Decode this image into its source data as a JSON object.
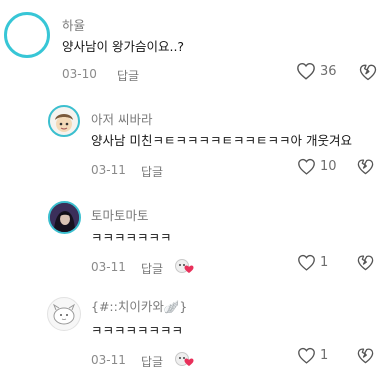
{
  "comments": [
    {
      "author": "하율",
      "text": "양사남이 왕가슴이요..?",
      "date": "03-10",
      "reply_label": "답글",
      "likes": "36",
      "avatar_icon": "avatar-ring-icon",
      "accent": "#37c6d6"
    },
    {
      "author": "아저 씨바라",
      "text": "양사남 미친ㅋㅌㅋㅋㅋㅋㅌㅋㅋㅌㅋㅋ아 개웃겨요",
      "date": "03-11",
      "reply_label": "답글",
      "likes": "10",
      "avatar_icon": "avatar-cartoon-icon"
    },
    {
      "author": "토마토마토",
      "text": "ㅋㅋㅋㅋㅋㅋㅋ",
      "date": "03-11",
      "reply_label": "답글",
      "likes": "1",
      "avatar_icon": "avatar-photo-icon",
      "creator_badge": "creator-liked-icon"
    },
    {
      "author": "{#::치이카와🪽}",
      "text": "ㅋㅋㅋㅋㅋㅋㅋㅋ",
      "date": "03-11",
      "reply_label": "답글",
      "likes": "1",
      "avatar_icon": "avatar-sketch-icon",
      "creator_badge": "creator-liked-icon"
    }
  ]
}
